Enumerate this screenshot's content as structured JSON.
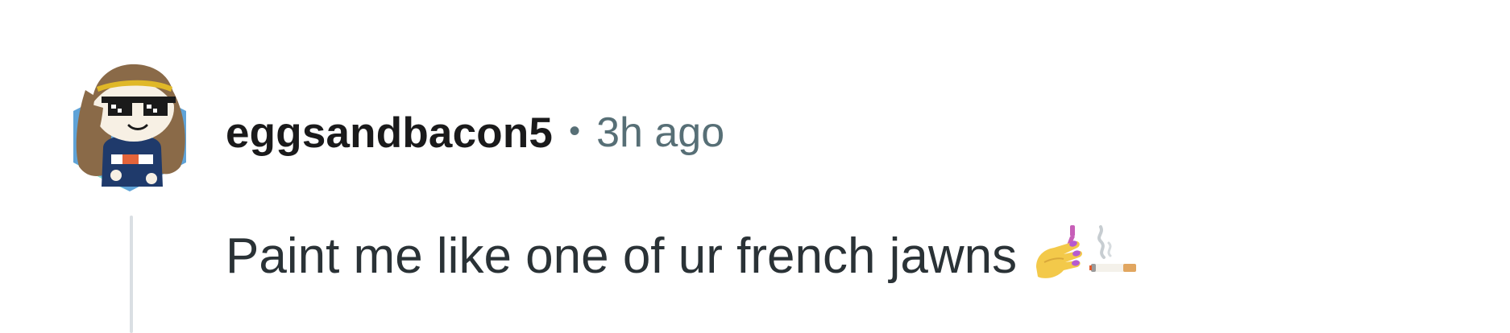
{
  "comment": {
    "author": "eggsandbacon5",
    "separator": "•",
    "timestamp": "3h ago",
    "body": "Paint me like one of ur french jawns",
    "emojis": [
      "nail-polish-icon",
      "cigarette-icon"
    ]
  },
  "colors": {
    "author_text": "#1a1a1b",
    "meta_text": "#576f76",
    "body_text": "#2a3236",
    "thread_line": "#dadfe3",
    "avatar_hex": "#5a9fd4"
  }
}
